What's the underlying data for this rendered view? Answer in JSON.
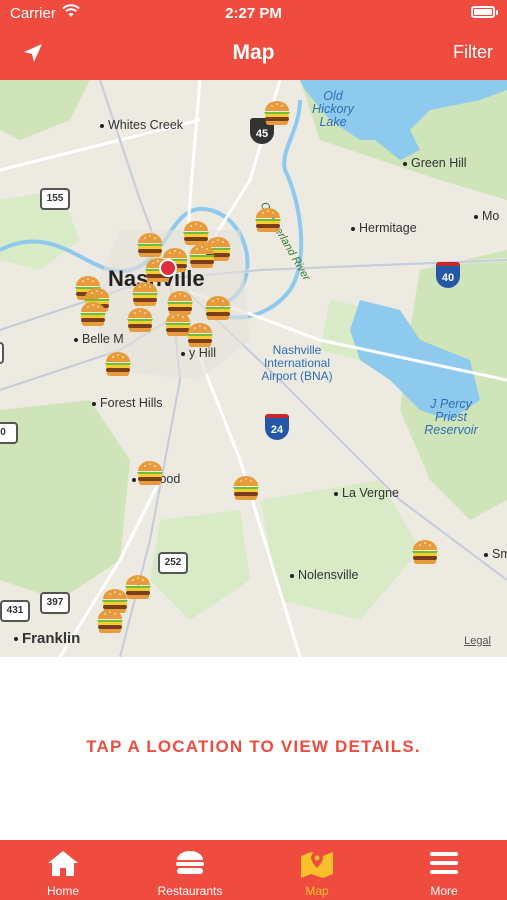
{
  "status_bar": {
    "carrier": "Carrier",
    "time": "2:27 PM"
  },
  "nav": {
    "title": "Map",
    "filter_label": "Filter",
    "locate_icon": "location-arrow-icon"
  },
  "map": {
    "places": {
      "whites_creek": "Whites Creek",
      "old_hickory_lake": "Old Hickory Lake",
      "green_hill": "Green Hill",
      "hermitage": "Hermitage",
      "cumberland_river": "Cumberland River",
      "nashville": "Nashville",
      "belle_meade": "Belle M",
      "berry_hill": "y Hill",
      "airport": "Nashville International Airport (BNA)",
      "forest_hills": "Forest Hills",
      "percy_priest": "J Percy Priest Reservoir",
      "brentwood": "ntwood",
      "la_vergne": "La Vergne",
      "nolensville": "Nolensville",
      "franklin": "Franklin",
      "mo": "Mo",
      "sm": "Sm"
    },
    "shields": {
      "i45": "45",
      "i155": "155",
      "i40": "40",
      "i24": "24",
      "r252": "252",
      "r397": "397",
      "r431": "431",
      "r0": "0"
    },
    "legal": "Legal",
    "pin_icon": "burger-pin-icon"
  },
  "details": {
    "message": "TAP A LOCATION TO VIEW DETAILS."
  },
  "tabs": [
    {
      "label": "Home",
      "icon": "home-icon",
      "active": false
    },
    {
      "label": "Restaurants",
      "icon": "burger-icon",
      "active": false
    },
    {
      "label": "Map",
      "icon": "map-icon",
      "active": true
    },
    {
      "label": "More",
      "icon": "menu-icon",
      "active": false
    }
  ],
  "colors": {
    "brand": "#EF4C3F",
    "active_tab": "#F9C02B"
  }
}
